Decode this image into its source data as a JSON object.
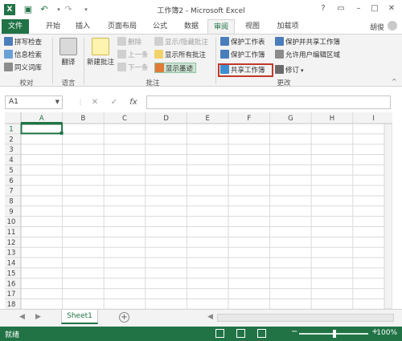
{
  "title_bar": {
    "title": "工作簿2 - Microsoft Excel",
    "qat_icons": [
      "excel-logo-icon",
      "save-icon",
      "undo-icon",
      "redo-icon",
      "customize-icon"
    ],
    "window_icons": [
      "help-icon",
      "ribbon-display-icon",
      "minimize-icon",
      "maximize-icon",
      "close-icon"
    ]
  },
  "tabs": [
    {
      "label": "文件"
    },
    {
      "label": "开始"
    },
    {
      "label": "插入"
    },
    {
      "label": "页面布局"
    },
    {
      "label": "公式"
    },
    {
      "label": "数据"
    },
    {
      "label": "审阅"
    },
    {
      "label": "视图"
    },
    {
      "label": "加载项"
    }
  ],
  "user": {
    "name": "胡俊"
  },
  "ribbon": {
    "proofing": {
      "spelling": "拼写检查",
      "research": "信息检索",
      "thesaurus": "同义词库",
      "label": "校对"
    },
    "language": {
      "translate": "翻译",
      "label": "语言"
    },
    "comments": {
      "new_comment": "新建批注",
      "delete": "删除",
      "previous": "上一条",
      "next": "下一条",
      "show_hide": "显示/隐藏批注",
      "show_all": "显示所有批注",
      "show_ink": "显示墨迹",
      "label": "批注"
    },
    "changes": {
      "protect_sheet": "保护工作表",
      "protect_workbook": "保护工作簿",
      "share_workbook": "共享工作簿",
      "protect_share": "保护并共享工作簿",
      "allow_edit_ranges": "允许用户编辑区域",
      "track_changes": "修订",
      "label": "更改"
    }
  },
  "formula_bar": {
    "name_box": "A1",
    "cancel": "✕",
    "enter": "✓",
    "fx": "fx",
    "value": ""
  },
  "grid": {
    "columns": [
      "A",
      "B",
      "C",
      "D",
      "E",
      "F",
      "G",
      "H",
      "I"
    ],
    "rows": [
      "1",
      "2",
      "3",
      "4",
      "5",
      "6",
      "7",
      "8",
      "9",
      "10",
      "11",
      "12",
      "13",
      "14",
      "15",
      "16",
      "17",
      "18"
    ],
    "selected_cell": "A1"
  },
  "sheets": {
    "tabs": [
      "Sheet1"
    ],
    "add": "+"
  },
  "status_bar": {
    "status": "就绪",
    "zoom": "100%"
  },
  "colors": {
    "accent": "#217346",
    "highlight_box": "#c0392b"
  }
}
